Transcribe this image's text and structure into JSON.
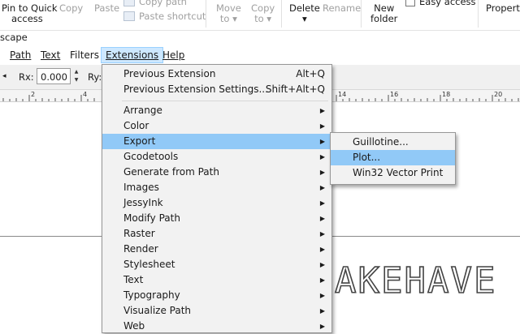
{
  "ribbon": {
    "pin_line1": "Pin to Quick",
    "pin_line2": "access",
    "copy": "Copy",
    "paste": "Paste",
    "copy_path": "Copy path",
    "paste_shortcut": "Paste shortcut",
    "move_to_line1": "Move",
    "move_to_line2": "to",
    "copy_to_line1": "Copy",
    "copy_to_line2": "to",
    "delete": "Delete",
    "rename": "Rename",
    "new_folder_line1": "New",
    "new_folder_line2": "folder",
    "easy_access": "Easy access",
    "properties": "Properti"
  },
  "window": {
    "title": "scape"
  },
  "menubar": {
    "path": "Path",
    "text": "Text",
    "filters": "Filters",
    "extensions": "Extensions",
    "help": "Help"
  },
  "toolbar": {
    "rx_label": "Rx:",
    "rx_value": "0.000",
    "ry_label": "Ry:"
  },
  "ruler": {
    "ticks": [
      "2",
      "4",
      "14",
      "16",
      "18",
      "20"
    ]
  },
  "canvas": {
    "outline_text": "AKEHAVE"
  },
  "extensions_menu": {
    "previous_extension": "Previous Extension",
    "previous_extension_shortcut": "Alt+Q",
    "previous_extension_settings": "Previous Extension Settings...",
    "previous_extension_settings_shortcut": "Shift+Alt+Q",
    "items": [
      "Arrange",
      "Color",
      "Export",
      "Gcodetools",
      "Generate from Path",
      "Images",
      "JessyInk",
      "Modify Path",
      "Raster",
      "Render",
      "Stylesheet",
      "Text",
      "Typography",
      "Visualize Path",
      "Web"
    ],
    "highlighted": "Export"
  },
  "export_menu": {
    "items": [
      "Guillotine...",
      "Plot...",
      "Win32 Vector Print"
    ],
    "highlighted": "Plot..."
  },
  "colors": {
    "menu_highlight": "#91c9f7",
    "menubar_active": "#cde8ff",
    "menu_bg": "#f2f2f2"
  }
}
